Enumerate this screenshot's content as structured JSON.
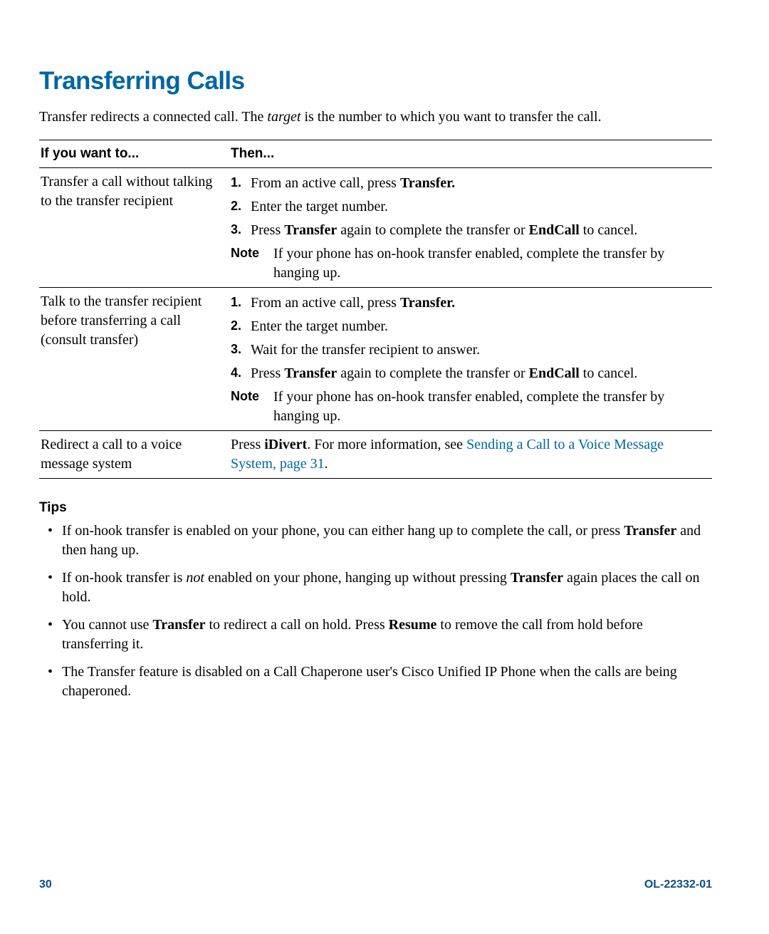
{
  "heading": "Transferring Calls",
  "intro": {
    "pre": "Transfer redirects a connected call. The ",
    "em": "target",
    "post": " is the number to which you want to transfer the call."
  },
  "table": {
    "headers": {
      "col1": "If you want to...",
      "col2": "Then..."
    },
    "row1": {
      "if": "Transfer a call without talking to the transfer recipient",
      "step1": {
        "num": "1.",
        "pre": "From an active call, press ",
        "b": "Transfer."
      },
      "step2": {
        "num": "2.",
        "text": "Enter the target number."
      },
      "step3": {
        "num": "3.",
        "pre": "Press ",
        "b1": "Transfer",
        "mid": " again to complete the transfer or ",
        "b2": "EndCall",
        "post": " to cancel."
      },
      "note": {
        "label": "Note",
        "text": "If your phone has on-hook transfer enabled, complete the transfer by hanging up."
      }
    },
    "row2": {
      "if": "Talk to the transfer recipient before transferring a call (consult transfer)",
      "step1": {
        "num": "1.",
        "pre": "From an active call, press ",
        "b": "Transfer."
      },
      "step2": {
        "num": "2.",
        "text": "Enter the target number."
      },
      "step3": {
        "num": "3.",
        "text": "Wait for the transfer recipient to answer."
      },
      "step4": {
        "num": "4.",
        "pre": "Press ",
        "b1": "Transfer",
        "mid": " again to complete the transfer or ",
        "b2": "EndCall",
        "post": " to cancel."
      },
      "note": {
        "label": "Note",
        "text": "If your phone has on-hook transfer enabled, complete the transfer by hanging up."
      }
    },
    "row3": {
      "if": "Redirect a call to a voice message system",
      "pre": "Press ",
      "b": "iDivert",
      "mid": ". For more information, see ",
      "link": "Sending a Call to a Voice Message System, page 31",
      "post": "."
    }
  },
  "tips_heading": "Tips",
  "tips": {
    "t1": {
      "pre": "If on-hook transfer is enabled on your phone, you can either hang up to complete the call, or press ",
      "b": "Transfer",
      "post": " and then hang up."
    },
    "t2": {
      "pre": "If on-hook transfer is ",
      "em": "not",
      "mid": " enabled on your phone, hanging up without pressing ",
      "b": "Transfer",
      "post": " again places the call on hold."
    },
    "t3": {
      "pre": "You cannot use ",
      "b1": "Transfer",
      "mid": " to redirect a call on hold. Press ",
      "b2": "Resume",
      "post": " to remove the call from hold before transferring it."
    },
    "t4": {
      "text": "The Transfer feature is disabled on a Call Chaperone user's Cisco Unified IP Phone when the calls are being chaperoned."
    }
  },
  "footer": {
    "page": "30",
    "docid": "OL-22332-01"
  }
}
